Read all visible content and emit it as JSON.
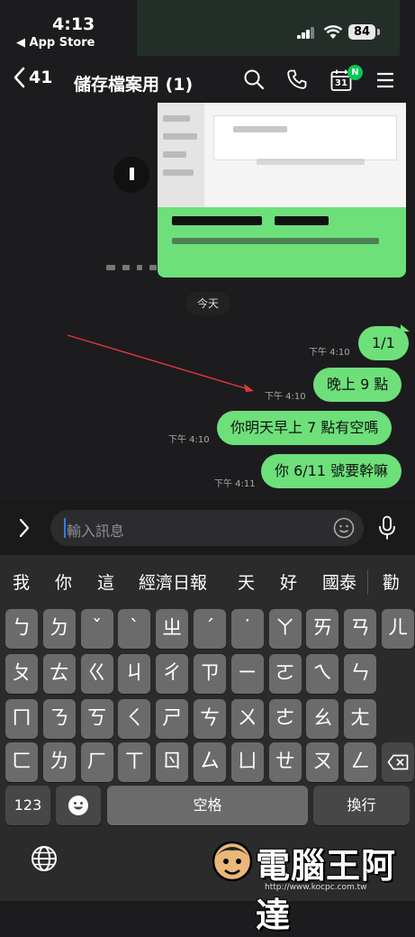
{
  "status_bar": {
    "time": "4:13",
    "back_to_app": "◀ App Store",
    "battery": "84"
  },
  "header": {
    "back_count": "41",
    "title": "儲存檔案用 (1)",
    "calendar_day": "31",
    "calendar_badge": "N",
    "icons": [
      "search-icon",
      "phone-icon",
      "calendar-icon",
      "menu-icon"
    ]
  },
  "chat": {
    "date_divider": "今天",
    "messages": [
      {
        "text": "1/1",
        "time": "下午 4:10"
      },
      {
        "text": "晚上 9 點",
        "time": "下午 4:10"
      },
      {
        "text": "你明天早上 7 點有空嗎",
        "time": "下午 4:10"
      },
      {
        "text": "你 6/11 號要幹嘛",
        "time": "下午 4:11"
      }
    ]
  },
  "input": {
    "placeholder": "輸入訊息"
  },
  "keyboard": {
    "suggestions": [
      "我",
      "你",
      "這",
      "經濟日報",
      "天",
      "好",
      "國泰",
      "勸"
    ],
    "row1": [
      "ㄅ",
      "ㄉ",
      "ˇ",
      "ˋ",
      "ㄓ",
      "ˊ",
      "˙",
      "ㄚ",
      "ㄞ",
      "ㄢ",
      "ㄦ"
    ],
    "row2": [
      "ㄆ",
      "ㄊ",
      "ㄍ",
      "ㄐ",
      "ㄔ",
      "ㄗ",
      "ㄧ",
      "ㄛ",
      "ㄟ",
      "ㄣ"
    ],
    "row3": [
      "ㄇ",
      "ㄋ",
      "ㄎ",
      "ㄑ",
      "ㄕ",
      "ㄘ",
      "ㄨ",
      "ㄜ",
      "ㄠ",
      "ㄤ"
    ],
    "row4": [
      "ㄈ",
      "ㄌ",
      "ㄏ",
      "ㄒ",
      "ㄖ",
      "ㄙ",
      "ㄩ",
      "ㄝ",
      "ㄡ",
      "ㄥ"
    ],
    "numbers_key": "123",
    "space_key": "空格",
    "return_key": "換行"
  },
  "watermark": {
    "text": "電腦王阿達",
    "url": "http://www.kocpc.com.tw"
  },
  "colors": {
    "bubble": "#6de07a",
    "accent": "#06c755",
    "background": "#1c1c1e"
  }
}
